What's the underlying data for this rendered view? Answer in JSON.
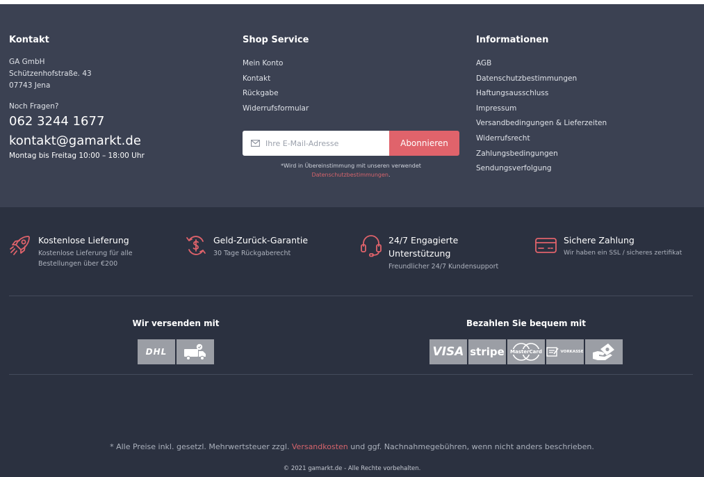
{
  "colors": {
    "top_bg": "#3b4152",
    "bottom_bg": "#2b3140",
    "accent": "#e0636b",
    "logo_bg": "#9b9ea5"
  },
  "contact": {
    "heading": "Kontakt",
    "company": "GA GmbH",
    "street": "Schützenhofstraße. 43",
    "city": "07743 Jena",
    "question": "Noch Fragen?",
    "phone": "062 3244 1677",
    "email": "kontakt@gamarkt.de",
    "hours": "Montag bis Freitag 10:00 – 18:00 Uhr"
  },
  "service": {
    "heading": "Shop Service",
    "links": [
      "Mein Konto",
      "Kontakt",
      "Rückgabe",
      "Widerrufsformular"
    ]
  },
  "newsletter": {
    "placeholder": "Ihre E-Mail-Adresse",
    "button": "Abonnieren",
    "consent_text": "*Wird in Übereinstimmung mit unseren verwendet",
    "consent_link": "Datenschutzbestimmungen",
    "consent_end": "."
  },
  "info": {
    "heading": "Informationen",
    "links": [
      "AGB",
      "Datenschutzbestimmungen",
      "Haftungsausschluss",
      "Impressum",
      "Versandbedingungen & Lieferzeiten",
      "Widerrufsrecht",
      "Zahlungsbedingungen",
      "Sendungsverfolgung"
    ]
  },
  "features": [
    {
      "icon": "rocket-icon",
      "title": "Kostenlose Lieferung",
      "desc": "Kostenlose Lieferung für alle Bestellungen über €200"
    },
    {
      "icon": "money-back-icon",
      "title": "Geld-Zurück-Garantie",
      "desc": "30 Tage Rückgaberecht"
    },
    {
      "icon": "headset-icon",
      "title": "24/7 Engagierte Unterstützung",
      "desc": "Freundlicher 24/7 Kundensupport"
    },
    {
      "icon": "credit-card-icon",
      "title": "Sichere Zahlung",
      "desc": "Wir haben ein SSL / sicheres zertifikat"
    }
  ],
  "shipping": {
    "heading": "Wir versenden mit",
    "logos": [
      "DHL"
    ]
  },
  "payment": {
    "heading": "Bezahlen Sie bequem mit",
    "logos": [
      "VISA",
      "stripe",
      "MasterCard",
      "VORKASSE"
    ]
  },
  "footer": {
    "note_start": "* Alle Preise inkl. gesetzl. Mehrwertsteuer zzgl.",
    "note_link": "Versandkosten",
    "note_end": "und ggf. Nachnahmegebühren, wenn nicht anders beschrieben.",
    "copyright": "© 2021 gamarkt.de - Alle Rechte vorbehalten."
  }
}
